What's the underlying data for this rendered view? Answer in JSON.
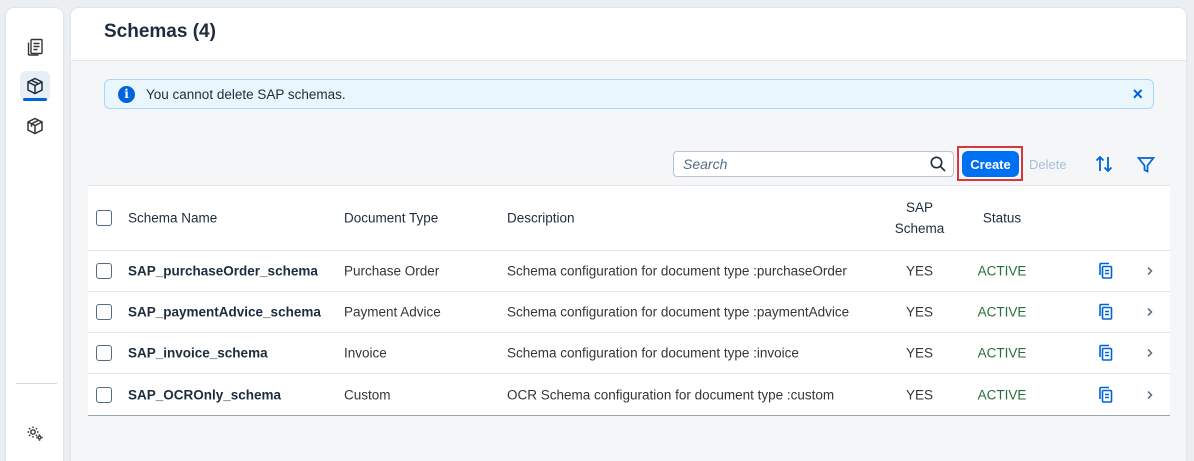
{
  "header": {
    "title": "Schemas (4)"
  },
  "info_strip": {
    "text": "You cannot delete SAP schemas.",
    "close_icon": "×",
    "info_icon": "i"
  },
  "toolbar": {
    "search_placeholder": "Search",
    "create_label": "Create",
    "delete_label": "Delete"
  },
  "table": {
    "columns": {
      "name": "Schema Name",
      "type": "Document Type",
      "description": "Description",
      "sap": "SAP Schema",
      "status": "Status"
    },
    "rows": [
      {
        "name": "SAP_purchaseOrder_schema",
        "type": "Purchase Order",
        "description": "Schema configuration for document type :purchaseOrder",
        "sap": "YES",
        "status": "ACTIVE"
      },
      {
        "name": "SAP_paymentAdvice_schema",
        "type": "Payment Advice",
        "description": "Schema configuration for document type :paymentAdvice",
        "sap": "YES",
        "status": "ACTIVE"
      },
      {
        "name": "SAP_invoice_schema",
        "type": "Invoice",
        "description": "Schema configuration for document type :invoice",
        "sap": "YES",
        "status": "ACTIVE"
      },
      {
        "name": "SAP_OCROnly_schema",
        "type": "Custom",
        "description": "OCR Schema configuration for document type :custom",
        "sap": "YES",
        "status": "ACTIVE"
      }
    ]
  },
  "colors": {
    "accent": "#0070f2",
    "status_active": "#256f3a",
    "highlight_border": "#d9363e",
    "info_strip_bg": "#e9f6fd"
  }
}
